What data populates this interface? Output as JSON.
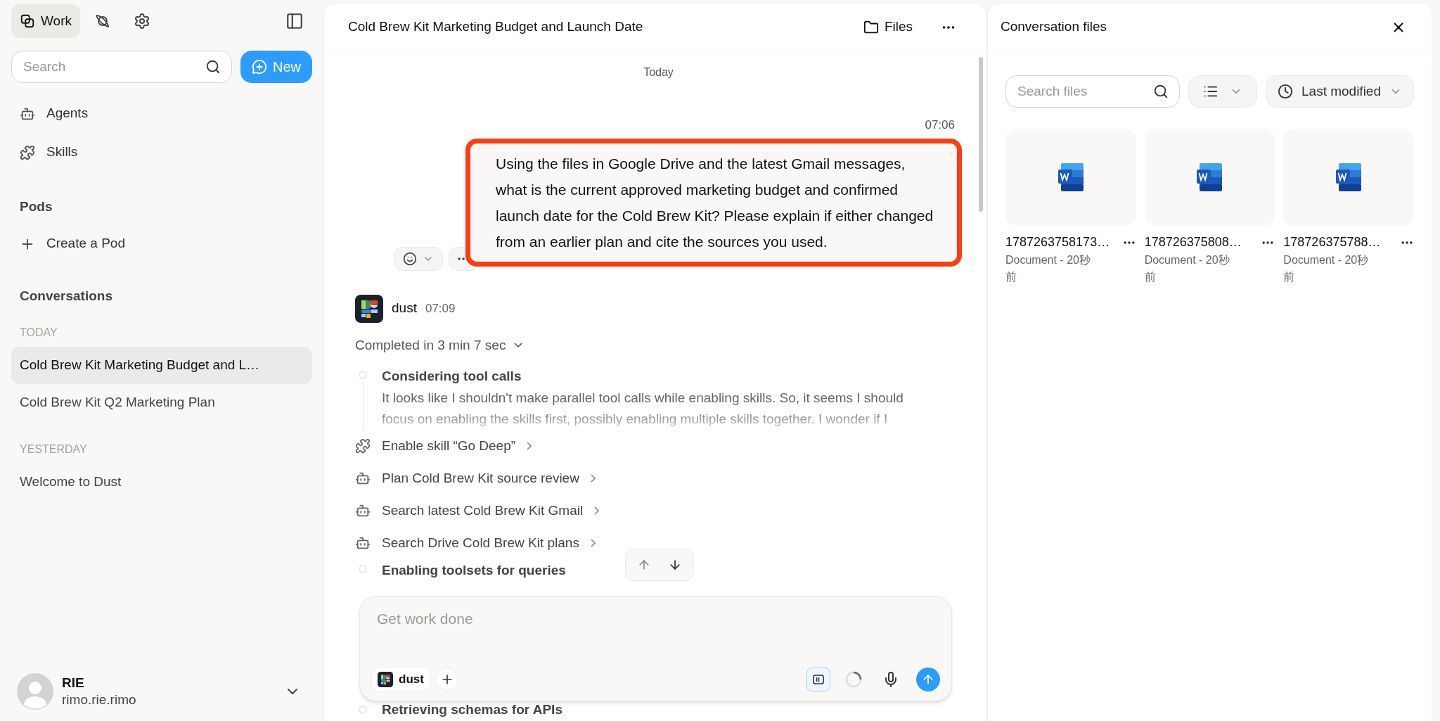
{
  "sidebar": {
    "top_tabs": [
      {
        "label": "Work",
        "kind": "work",
        "selected": true
      },
      {
        "kind": "explore",
        "selected": false
      },
      {
        "kind": "settings",
        "selected": false
      }
    ],
    "search": {
      "placeholder": "Search"
    },
    "new_button": "New",
    "nav": [
      {
        "label": "Agents",
        "kind": "agent"
      },
      {
        "label": "Skills",
        "kind": "skill"
      }
    ],
    "pods": {
      "title": "Pods",
      "create": "Create a Pod"
    },
    "conversations": {
      "title": "Conversations",
      "groups": [
        {
          "label": "TODAY",
          "items": [
            {
              "title": "Cold Brew Kit Marketing Budget and L…",
              "selected": true
            },
            {
              "title": "Cold Brew Kit Q2 Marketing Plan",
              "selected": false
            }
          ]
        },
        {
          "label": "YESTERDAY",
          "items": [
            {
              "title": "Welcome to Dust",
              "selected": false
            }
          ]
        }
      ]
    },
    "user": {
      "name": "RIE",
      "handle": "rimo.rie.rimo"
    }
  },
  "conversation": {
    "title": "Cold Brew Kit Marketing Budget and Launch Date",
    "files_button": "Files",
    "day": "Today",
    "user_message": {
      "time": "07:06",
      "text": "Using the files in Google Drive and the latest Gmail messages, what is the current approved marketing budget and confirmed launch date for the Cold Brew Kit? Please explain if either changed from an earlier plan and cite the sources you used.",
      "highlighted": true
    },
    "agent": {
      "name": "dust",
      "time": "07:09",
      "status": "Completed in 3 min 7 sec",
      "steps": [
        {
          "kind": "thinking",
          "title": "Considering tool calls",
          "body": "It looks like I shouldn't make parallel tool calls while enabling skills. So, it seems I should focus on enabling the skills first, possibly enabling multiple skills together. I wonder if I"
        },
        {
          "kind": "skill",
          "label": "Enable skill “Go Deep”"
        },
        {
          "kind": "agent",
          "label": "Plan Cold Brew Kit source review"
        },
        {
          "kind": "agent",
          "label": "Search latest Cold Brew Kit Gmail"
        },
        {
          "kind": "agent",
          "label": "Search Drive Cold Brew Kit plans"
        },
        {
          "kind": "thinking",
          "title": "Enabling toolsets for queries"
        }
      ],
      "last_step": "Retrieving schemas for APIs"
    },
    "composer": {
      "placeholder": "Get work done",
      "agent": "dust"
    }
  },
  "files_panel": {
    "title": "Conversation files",
    "search": {
      "placeholder": "Search files"
    },
    "sort": "Last modified",
    "files": [
      {
        "name": "1787263758173…",
        "meta": "Document - 20秒前"
      },
      {
        "name": "178726375808…",
        "meta": "Document - 20秒前"
      },
      {
        "name": "178726375788…",
        "meta": "Document - 20秒前"
      }
    ]
  }
}
